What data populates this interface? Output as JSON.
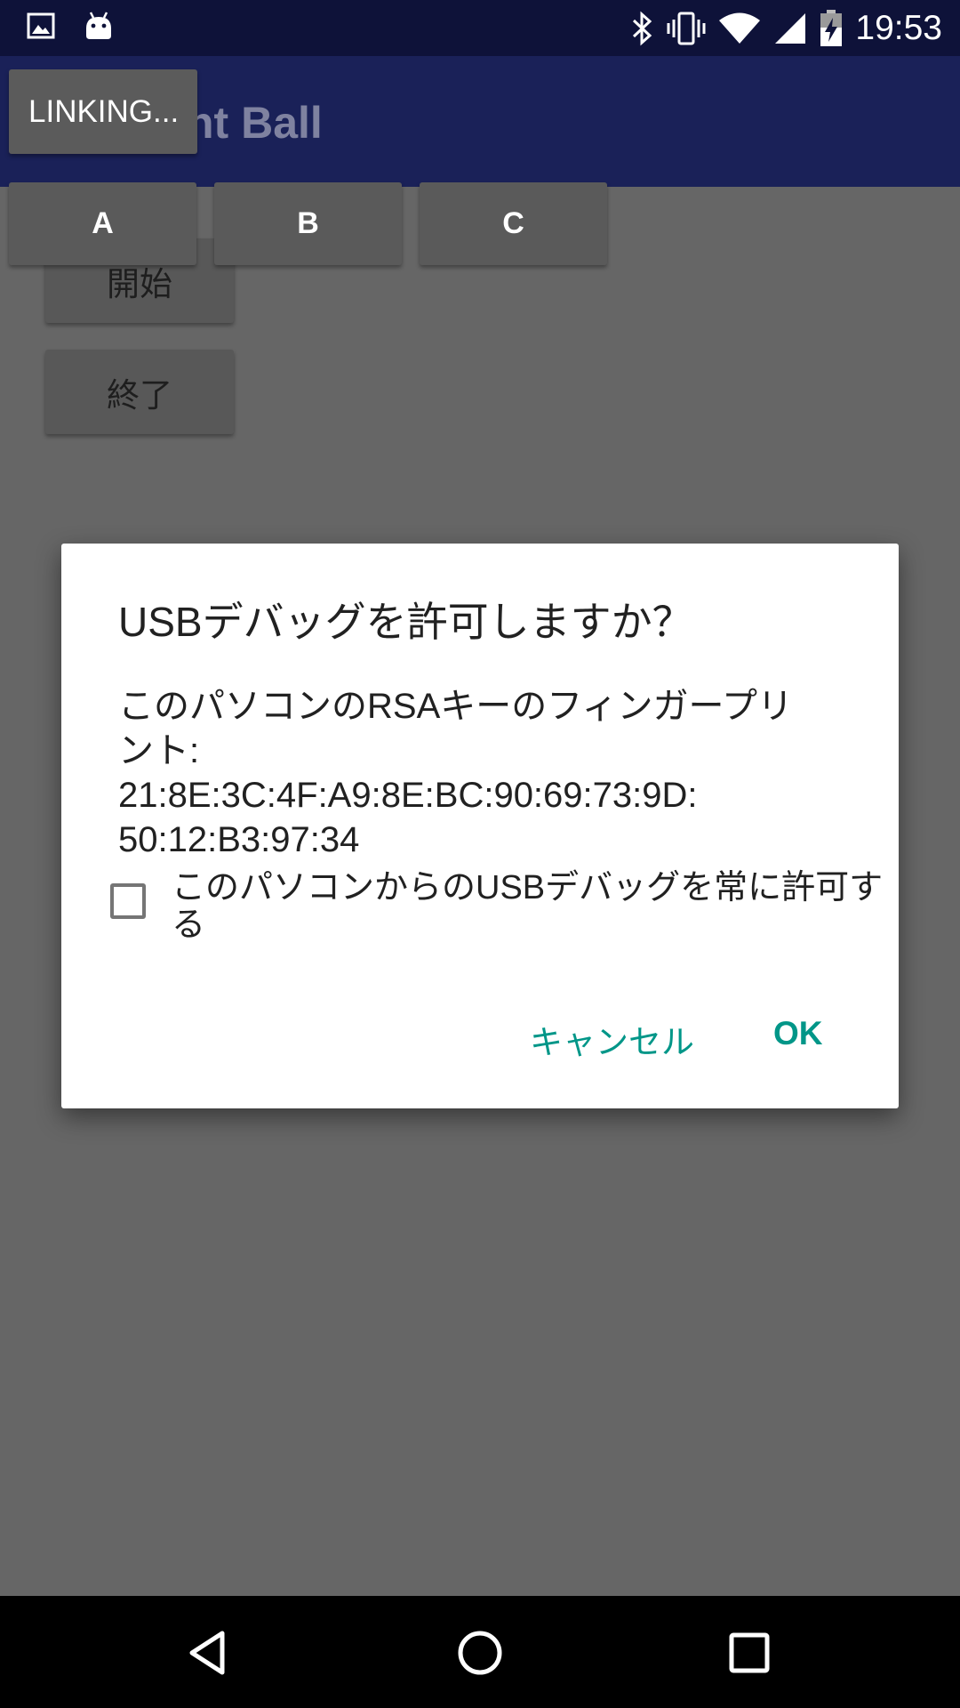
{
  "status_bar": {
    "time": "19:53",
    "icons": [
      "image-icon",
      "android-icon",
      "bluetooth-icon",
      "vibrate-icon",
      "wifi-icon",
      "signal-icon",
      "battery-charging-icon"
    ]
  },
  "app_bar": {
    "title": "nt Ball"
  },
  "buttons": {
    "linking": "LINKING...",
    "a": "A",
    "b": "B",
    "c": "C",
    "start": "開始",
    "end": "終了"
  },
  "dialog": {
    "title": "USBデバッグを許可しますか？",
    "message_lines": [
      "このパソコンのRSAキーのフィンガープリ",
      "ント:",
      "21:8E:3C:4F:A9:8E:BC:90:69:73:9D:",
      "50:12:B3:97:34"
    ],
    "checkbox_label_lines": [
      "このパソコンからのUSBデバッグを常に許可す",
      "る"
    ],
    "checkbox_checked": false,
    "cancel_label": "キャンセル",
    "ok_label": "OK",
    "accent_color": "#009688"
  },
  "nav_bar": {
    "icons": [
      "back-icon",
      "home-icon",
      "recent-apps-icon"
    ]
  }
}
